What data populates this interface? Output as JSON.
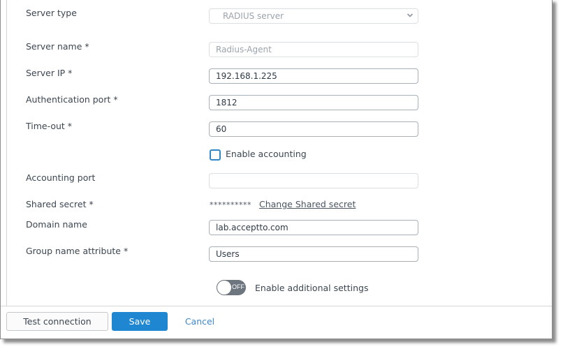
{
  "form": {
    "server_type": {
      "label": "Server type",
      "value": "RADIUS server"
    },
    "server_name": {
      "label": "Server name *",
      "value": "Radius-Agent"
    },
    "server_ip": {
      "label": "Server IP *",
      "value": "192.168.1.225"
    },
    "auth_port": {
      "label": "Authentication port *",
      "value": "1812"
    },
    "timeout": {
      "label": "Time-out *",
      "value": "60"
    },
    "enable_accounting": {
      "label": "Enable accounting",
      "checked": false
    },
    "accounting_port": {
      "label": "Accounting port",
      "value": ""
    },
    "shared_secret": {
      "label": "Shared secret *",
      "masked_value": "**********",
      "change_link": "Change Shared secret"
    },
    "domain_name": {
      "label": "Domain name",
      "value": "lab.acceptto.com"
    },
    "group_name_attribute": {
      "label": "Group name attribute *",
      "value": "Users"
    },
    "additional_settings": {
      "toggle_state": "OFF",
      "label": "Enable additional settings"
    }
  },
  "footer": {
    "test_connection": "Test connection",
    "save": "Save",
    "cancel": "Cancel"
  },
  "colors": {
    "primary": "#1f87d2",
    "link": "#3f86c8",
    "checkbox_border": "#3187c6",
    "toggle_off": "#6d757e"
  }
}
